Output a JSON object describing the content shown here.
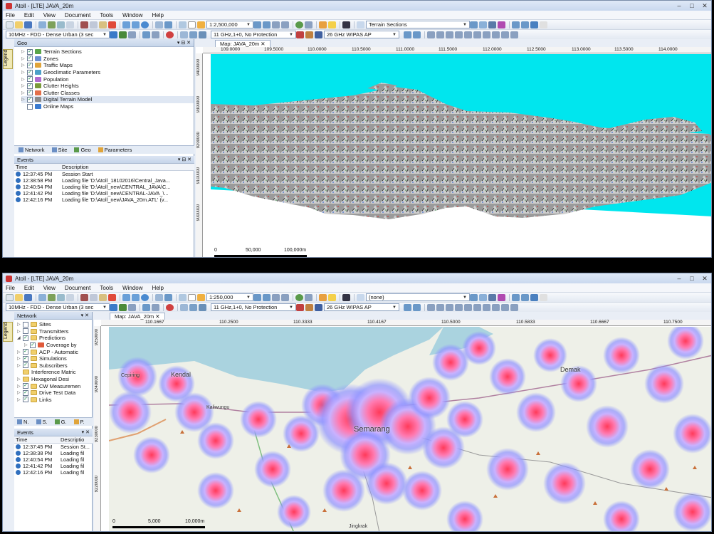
{
  "top": {
    "title": "Atoll - [LTE] JAVA_20m",
    "menu": [
      "File",
      "Edit",
      "View",
      "Document",
      "Tools",
      "Window",
      "Help"
    ],
    "scale": "1:2,500,000",
    "layer_combo": "Terrain Sections",
    "radio_combo": "10MHz - FDD - Dense Urban (3 sec",
    "freq_combo": "11 GHz,1+0, No Protection",
    "ap_combo": "26 GHz WIPAS AP",
    "panel_title": "Geo",
    "tree": [
      {
        "label": "Terrain Sections",
        "checked": true,
        "color": "#5aa64a"
      },
      {
        "label": "Zones",
        "checked": true,
        "color": "#6b8fd1"
      },
      {
        "label": "Traffic Maps",
        "checked": true,
        "color": "#e0a43a"
      },
      {
        "label": "Geoclimatic Parameters",
        "checked": true,
        "color": "#4ca0c8"
      },
      {
        "label": "Population",
        "checked": true,
        "color": "#b06ad0"
      },
      {
        "label": "Clutter Heights",
        "checked": true,
        "color": "#7a9a3a"
      },
      {
        "label": "Clutter Classes",
        "checked": true,
        "color": "#e36f4a"
      },
      {
        "label": "Digital Terrain Model",
        "checked": true,
        "color": "#8a8a8a"
      },
      {
        "label": "Online Maps",
        "checked": false,
        "color": "#3a7ad0"
      }
    ],
    "tabs": [
      "Network",
      "Site",
      "Geo",
      "Parameters"
    ],
    "events_title": "Events",
    "events_headers": [
      "Time",
      "Description"
    ],
    "events": [
      {
        "time": "12:37:45 PM",
        "desc": "Session Start"
      },
      {
        "time": "12:38:58 PM",
        "desc": "Loading file 'D:\\Atoll_18102016\\Central_Java..."
      },
      {
        "time": "12:40:54 PM",
        "desc": "Loading file 'D:\\Atoll_new\\CENTRAL_JAVA\\C..."
      },
      {
        "time": "12:41:42 PM",
        "desc": "Loading file 'D:\\Atoll_new\\CENTRAL-JAVA_\\..."
      },
      {
        "time": "12:42:16 PM",
        "desc": "Loading file 'D:\\Atoll_new\\JAVA_20m.ATL' (v..."
      }
    ],
    "map_tab": "Map: JAVA_20m",
    "ruler_x": [
      "109.0000",
      "109.5000",
      "110.0000",
      "110.5000",
      "111.0000",
      "111.5000",
      "112.0000",
      "112.5000",
      "113.0000",
      "113.5000",
      "114.0000"
    ],
    "ruler_y": [
      "9400000",
      "9300000",
      "9200000",
      "9100000",
      "9000000"
    ],
    "scalebar": [
      "0",
      "50,000",
      "100,000m"
    ],
    "legend": "Legend"
  },
  "bottom": {
    "title": "Atoll - [LTE] JAVA_20m",
    "menu": [
      "File",
      "Edit",
      "View",
      "Document",
      "Tools",
      "Window",
      "Help"
    ],
    "scale": "1:250,000",
    "layer_combo": "(none)",
    "radio_combo": "10MHz - FDD - Dense Urban (3 sec",
    "freq_combo": "11 GHz,1+0, No Protection",
    "ap_combo": "26 GHz WIPAS AP",
    "panel_title": "Network",
    "tree": [
      {
        "label": "Sites",
        "checked": false,
        "indent": 0
      },
      {
        "label": "Transmitters",
        "checked": false,
        "indent": 0
      },
      {
        "label": "Predictions",
        "checked": true,
        "indent": 0
      },
      {
        "label": "Coverage by",
        "checked": true,
        "indent": 1
      },
      {
        "label": "ACP - Automatic",
        "checked": true,
        "indent": 0
      },
      {
        "label": "Simulations",
        "checked": true,
        "indent": 0
      },
      {
        "label": "Subscribers",
        "checked": true,
        "indent": 0
      },
      {
        "label": "Interference Matric",
        "checked": false,
        "indent": 0
      },
      {
        "label": "Hexagonal Desi",
        "checked": false,
        "indent": 0
      },
      {
        "label": "CW Measuremen",
        "checked": true,
        "indent": 0
      },
      {
        "label": "Drive Test Data",
        "checked": true,
        "indent": 0
      },
      {
        "label": "Links",
        "checked": true,
        "indent": 0
      }
    ],
    "tabs": [
      "N.",
      "S.",
      "G.",
      "P."
    ],
    "events_title": "Events",
    "events_headers": [
      "Time",
      "Descriptio"
    ],
    "events": [
      {
        "time": "12:37:45 PM",
        "desc": "Session St..."
      },
      {
        "time": "12:38:38 PM",
        "desc": "Loading fil"
      },
      {
        "time": "12:40:54 PM",
        "desc": "Loading fil"
      },
      {
        "time": "12:41:42 PM",
        "desc": "Loading fil"
      },
      {
        "time": "12:42:16 PM",
        "desc": "Loading fil"
      }
    ],
    "map_tab": "Map: JAVA_20m",
    "ruler_x": [
      "110.1667",
      "110.2500",
      "110.3333",
      "110.4167",
      "110.5000",
      "110.5833",
      "110.6667",
      "110.7500"
    ],
    "ruler_y": [
      "9250000",
      "9240000",
      "9230000",
      "9220000"
    ],
    "scalebar": [
      "0",
      "5,000",
      "10,000m"
    ],
    "places": [
      "Cepiring",
      "Kendal",
      "Kaliwungu",
      "Semarang",
      "Demak",
      "Jingkrak"
    ],
    "legend": "Legend"
  }
}
